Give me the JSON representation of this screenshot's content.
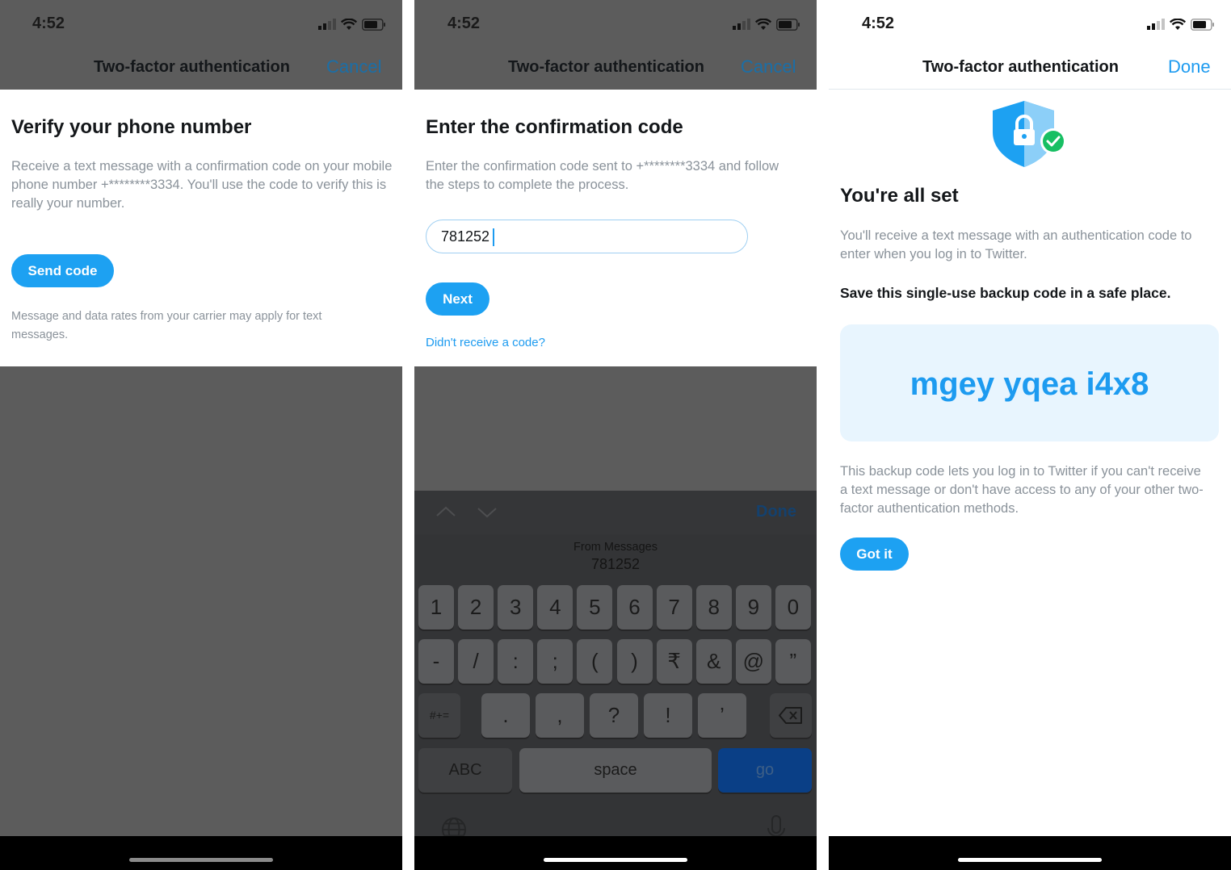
{
  "status": {
    "time": "4:52"
  },
  "screen1": {
    "nav": {
      "title": "Two-factor authentication",
      "action": "Cancel"
    },
    "heading": "Verify your phone number",
    "body": "Receive a text message with a confirmation code on your mobile phone number +********3334. You'll use the code to verify this is really your number.",
    "button": "Send code",
    "footnote": "Message and data rates from your carrier may apply for text messages."
  },
  "screen2": {
    "nav": {
      "title": "Two-factor authentication",
      "action": "Cancel"
    },
    "heading": "Enter the confirmation code",
    "body": "Enter the confirmation code sent to +********3334 and follow the steps to complete the process.",
    "code_value": "781252",
    "button": "Next",
    "link": "Didn't receive a code?",
    "keyboard": {
      "done": "Done",
      "suggestion_source": "From Messages",
      "suggestion_value": "781252",
      "row1": [
        "1",
        "2",
        "3",
        "4",
        "5",
        "6",
        "7",
        "8",
        "9",
        "0"
      ],
      "row2": [
        "-",
        "/",
        ":",
        ";",
        "(",
        ")",
        "₹",
        "&",
        "@",
        "”"
      ],
      "row3": [
        ".",
        ",",
        "?",
        "!",
        "’"
      ],
      "symbols_key": "#+=",
      "abc_key": "ABC",
      "space_key": "space",
      "go_key": "go"
    }
  },
  "screen3": {
    "nav": {
      "title": "Two-factor authentication",
      "action": "Done"
    },
    "heading": "You're all set",
    "body": "You'll receive a text message with an authentication code to enter when you log in to Twitter.",
    "save_note": "Save this single-use backup code in a safe place.",
    "backup_code": "mgey yqea i4x8",
    "explanation": "This backup code lets you log in to Twitter if you can't receive a text message or don't have access to any of your other two-factor authentication methods.",
    "button": "Got it"
  },
  "colors": {
    "accent": "#1da1f2",
    "dim_overlay": "#5c5c5c",
    "code_box": "#e8f5fe"
  }
}
